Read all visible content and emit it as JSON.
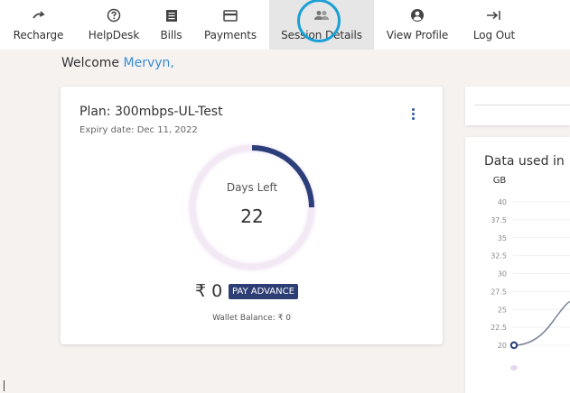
{
  "nav": {
    "items": [
      {
        "label": "Recharge",
        "icon": "recharge-icon"
      },
      {
        "label": "HelpDesk",
        "icon": "help-icon"
      },
      {
        "label": "Bills",
        "icon": "bills-icon"
      },
      {
        "label": "Payments",
        "icon": "payments-icon"
      },
      {
        "label": "Session Details",
        "icon": "session-icon"
      },
      {
        "label": "View Profile",
        "icon": "profile-icon"
      },
      {
        "label": "Log Out",
        "icon": "logout-icon"
      }
    ],
    "active_index": 4
  },
  "welcome": {
    "prefix": "Welcome",
    "username": "Mervyn,"
  },
  "plan": {
    "label": "Plan:",
    "name": "300mbps-UL-Test",
    "expiry_label": "Expiry date:",
    "expiry_date": "Dec 11, 2022",
    "days_left_label": "Days Left",
    "days_left": "22",
    "days_progress_fraction": 0.25,
    "amount": "₹ 0",
    "pay_button": "PAY ADVANCE",
    "wallet": "Wallet Balance: ₹ 0"
  },
  "usage": {
    "chart_data": {
      "type": "line",
      "title": "Data used in",
      "ylabel": "GB",
      "y_ticks": [
        "40",
        "37.5",
        "35",
        "32.5",
        "30",
        "27.5",
        "25",
        "22.5",
        "20"
      ],
      "ylim": [
        20,
        40
      ],
      "series": [
        {
          "values": [
            20
          ]
        }
      ]
    }
  },
  "colors": {
    "accent": "#2d3e74",
    "link": "#3a8dd1",
    "gauge": "#2b3f7a",
    "highlight": "#1ba0d6"
  }
}
